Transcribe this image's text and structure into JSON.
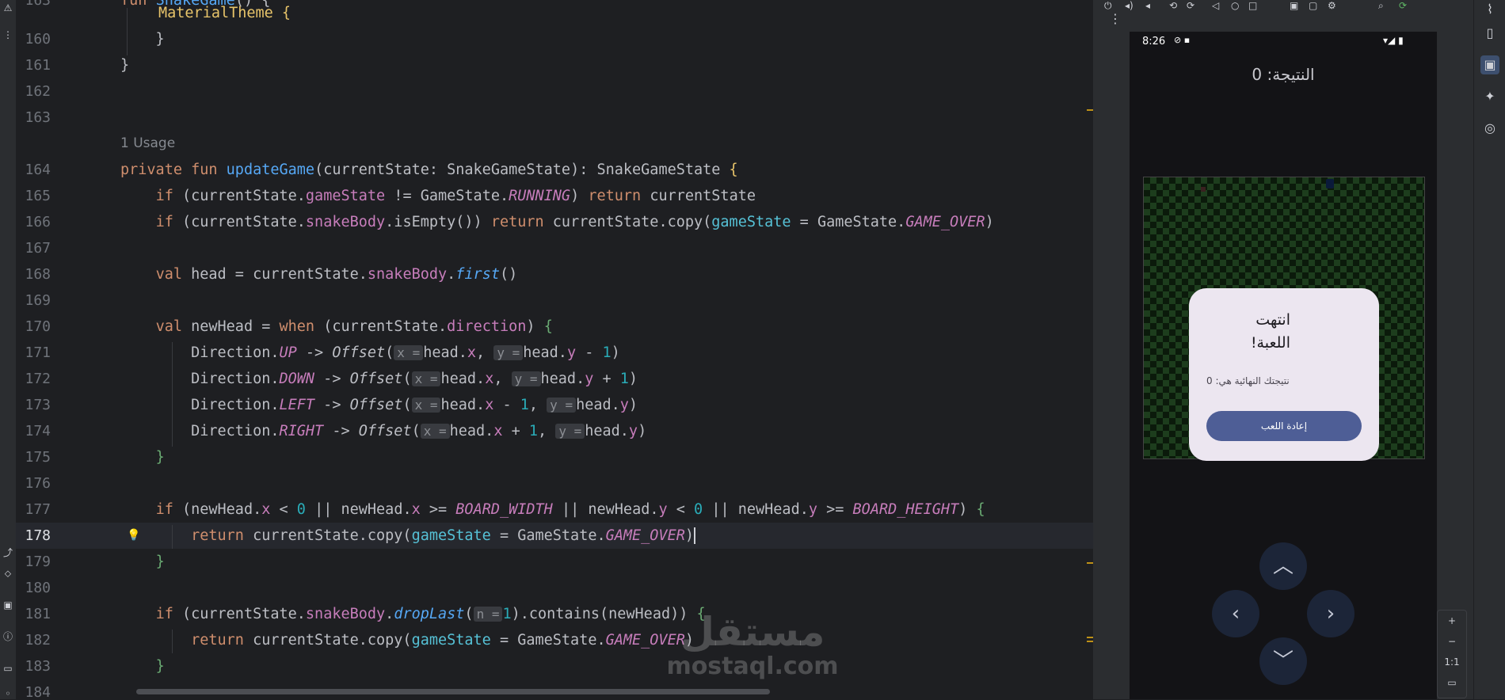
{
  "left_strip": {
    "icons": [
      "warning-icon",
      "more-vertical-icon",
      "run-icon",
      "plugin-icon",
      "terminal-icon",
      "problems-icon",
      "services-icon",
      "git-icon"
    ]
  },
  "editor": {
    "lines": [
      {
        "n": "163",
        "text": "fun SnakeGame() {"
      },
      {
        "n": "160",
        "text": "    }"
      },
      {
        "n": "161",
        "text": "}"
      },
      {
        "n": "162",
        "text": ""
      },
      {
        "n": "163",
        "text": ""
      },
      {
        "n": "",
        "text": "1 Usage"
      },
      {
        "n": "164",
        "text": "private fun updateGame(currentState: SnakeGameState): SnakeGameState {"
      },
      {
        "n": "165",
        "text": "if (currentState.gameState != GameState.RUNNING) return currentState"
      },
      {
        "n": "166",
        "text": "if (currentState.snakeBody.isEmpty()) return currentState.copy(gameState = GameState.GAME_OVER)"
      },
      {
        "n": "167",
        "text": ""
      },
      {
        "n": "168",
        "text": "val head = currentState.snakeBody.first()"
      },
      {
        "n": "169",
        "text": ""
      },
      {
        "n": "170",
        "text": "val newHead = when (currentState.direction) {"
      },
      {
        "n": "171",
        "text": "Direction.UP -> Offset( x = head.x, y = head.y - 1)"
      },
      {
        "n": "172",
        "text": "Direction.DOWN -> Offset( x = head.x, y = head.y + 1)"
      },
      {
        "n": "173",
        "text": "Direction.LEFT -> Offset( x = head.x - 1, y = head.y)"
      },
      {
        "n": "174",
        "text": "Direction.RIGHT -> Offset( x = head.x + 1, y = head.y)"
      },
      {
        "n": "175",
        "text": "}"
      },
      {
        "n": "176",
        "text": ""
      },
      {
        "n": "177",
        "text": "if (newHead.x < 0 || newHead.x >= BOARD_WIDTH || newHead.y < 0 || newHead.y >= BOARD_HEIGHT) {"
      },
      {
        "n": "178",
        "text": "return currentState.copy(gameState = GameState.GAME_OVER)"
      },
      {
        "n": "179",
        "text": "}"
      },
      {
        "n": "180",
        "text": ""
      },
      {
        "n": "181",
        "text": "if (currentState.snakeBody.dropLast( n = 1).contains(newHead)) {"
      },
      {
        "n": "182",
        "text": "return currentState.copy(gameState = GameState.GAME_OVER)"
      },
      {
        "n": "183",
        "text": "}"
      },
      {
        "n": "184",
        "text": ""
      }
    ],
    "top_partial_line": "MaterialTheme {",
    "current_line": "178",
    "usage_label": "1 Usage"
  },
  "emulator": {
    "status_time": "8:26",
    "score_label": "النتيجة: 0",
    "dialog": {
      "title": "انتهت اللعبة!",
      "message": "نتيجتك النهائية هي: 0",
      "button": "إعادة اللعب"
    },
    "dpad": {
      "up": "︿",
      "down": "﹀",
      "left": "‹",
      "right": "›"
    },
    "zoom": {
      "plus": "+",
      "minus": "−",
      "ratio": "1:1"
    }
  },
  "right_strip": {
    "icons": [
      "chart-icon",
      "device-manager-icon",
      "running-devices-icon",
      "gemini-icon",
      "android-icon"
    ]
  },
  "watermark": {
    "arabic": "مستقل",
    "latin": "mostaql.com"
  },
  "colors": {
    "keyword": "#cf8e6d",
    "function": "#56a8f5",
    "property": "#c77dbb",
    "number": "#2aacb8",
    "dialog_button": "#4e5e96"
  }
}
